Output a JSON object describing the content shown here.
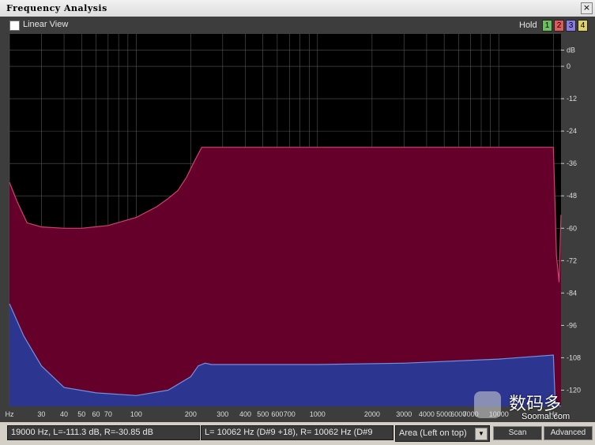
{
  "window": {
    "title": "Frequency Analysis",
    "close_glyph": "×"
  },
  "toolbar": {
    "linear_view_label": "Linear View",
    "linear_view_checked": false,
    "hold_label": "Hold",
    "hold_buttons": [
      {
        "label": "1",
        "color": "#6bbf5a"
      },
      {
        "label": "2",
        "color": "#e05a5a"
      },
      {
        "label": "3",
        "color": "#8a7be0"
      },
      {
        "label": "4",
        "color": "#e0d26a"
      }
    ]
  },
  "chart_data": {
    "type": "area",
    "x_scale": "log",
    "xlim": [
      20,
      22050
    ],
    "ylim": [
      -126,
      12
    ],
    "yunit": "dB",
    "xunit": "Hz",
    "x_ticks": [
      "Hz",
      "30",
      "40",
      "50",
      "60",
      "70",
      "100",
      "200",
      "300",
      "400",
      "500",
      "600",
      "700",
      "1000",
      "2000",
      "3000",
      "4000",
      "5000",
      "6000",
      "7000",
      "10000",
      "Hz"
    ],
    "x_tick_values": [
      20,
      30,
      40,
      50,
      60,
      70,
      100,
      200,
      300,
      400,
      500,
      600,
      700,
      1000,
      2000,
      3000,
      4000,
      5000,
      6000,
      7000,
      10000,
      20000
    ],
    "y_ticks": [
      "dB",
      "0",
      "-12",
      "-24",
      "-36",
      "-48",
      "-60",
      "-72",
      "-84",
      "-96",
      "-108",
      "-120"
    ],
    "y_tick_values": [
      6,
      0,
      -12,
      -24,
      -36,
      -48,
      -60,
      -72,
      -84,
      -96,
      -108,
      -120
    ],
    "grid": true,
    "colors": {
      "background": "#000000",
      "grid": "#555555",
      "left_fill": "#64002a",
      "left_line": "#d04070",
      "right_fill": "#2c3590",
      "right_line": "#7090e0"
    },
    "series": [
      {
        "x": [
          20,
          22,
          25,
          30,
          40,
          50,
          70,
          100,
          130,
          150,
          170,
          190,
          210,
          230,
          250,
          270,
          300,
          1000,
          5000,
          10000,
          20000,
          20300,
          20800,
          21500,
          22050
        ],
        "y": [
          -43,
          -50,
          -58,
          -59.5,
          -60,
          -60,
          -59,
          -56,
          -52,
          -49,
          -46,
          -41,
          -35,
          -30,
          -30,
          -30,
          -30,
          -30,
          -30,
          -30,
          -30,
          -45,
          -70,
          -80,
          -55
        ]
      },
      {
        "x": [
          20,
          24,
          30,
          40,
          60,
          100,
          150,
          200,
          220,
          240,
          260,
          300,
          1000,
          3000,
          10000,
          20000,
          20500,
          22050
        ],
        "y": [
          -88,
          -100,
          -111,
          -119,
          -121,
          -122,
          -120,
          -115,
          -111,
          -110,
          -110.5,
          -110.5,
          -110.5,
          -110,
          -108.5,
          -107,
          -125,
          -126
        ]
      }
    ]
  },
  "status": {
    "cursor_readout": "19000 Hz, L=-111.3 dB, R=-30.85 dB",
    "peak_readout": "L=  10062 Hz (D#9 +18), R=  10062 Hz (D#9",
    "view_mode": "Area (Left on top)",
    "scan_label": "Scan",
    "advanced_label": "Advanced"
  },
  "watermark": {
    "cn": "数码多",
    "en": "Soomal.com"
  }
}
